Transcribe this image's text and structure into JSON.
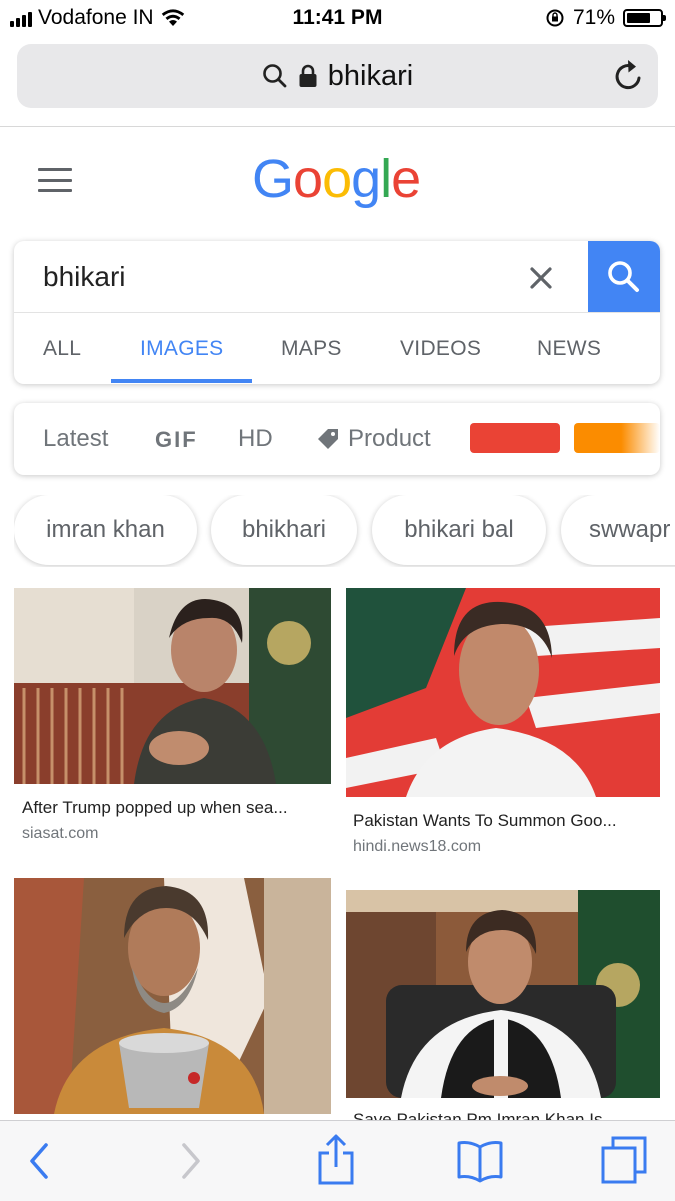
{
  "status_bar": {
    "carrier": "Vodafone IN",
    "time": "11:41 PM",
    "battery": "71%",
    "battery_level": 0.71
  },
  "browser": {
    "url_text": "bhikari",
    "icons": [
      "search-icon",
      "lock-icon",
      "reload-icon"
    ]
  },
  "google": {
    "logo_letters": [
      {
        "ch": "G",
        "color": "#4285f4"
      },
      {
        "ch": "o",
        "color": "#ea4335"
      },
      {
        "ch": "o",
        "color": "#fbbc05"
      },
      {
        "ch": "g",
        "color": "#4285f4"
      },
      {
        "ch": "l",
        "color": "#34a853"
      },
      {
        "ch": "e",
        "color": "#ea4335"
      }
    ],
    "search_query": "bhikari",
    "accent": "#4285f4"
  },
  "tabs": [
    "ALL",
    "IMAGES",
    "MAPS",
    "VIDEOS",
    "NEWS"
  ],
  "active_tab": "IMAGES",
  "filters": {
    "latest": "Latest",
    "gif": "GIF",
    "hd": "HD",
    "product": "Product",
    "color_chips": [
      "#ea4335",
      "#fb8c00"
    ]
  },
  "suggestions": [
    "imran khan",
    "bhikhari",
    "bhikari bal",
    "swwapr"
  ],
  "results": [
    {
      "title": "After Trump popped up when sea...",
      "source": "siasat.com"
    },
    {
      "title": "Pakistan Wants To Summon Goo...",
      "source": "hindi.news18.com"
    },
    {
      "title": "",
      "source": ""
    },
    {
      "title": "Save Pakistan Pm Imran Khan Is",
      "source": ""
    }
  ],
  "toolbar": {
    "icons": [
      "back-icon",
      "forward-icon",
      "share-icon",
      "bookmarks-icon",
      "tabs-icon"
    ]
  }
}
